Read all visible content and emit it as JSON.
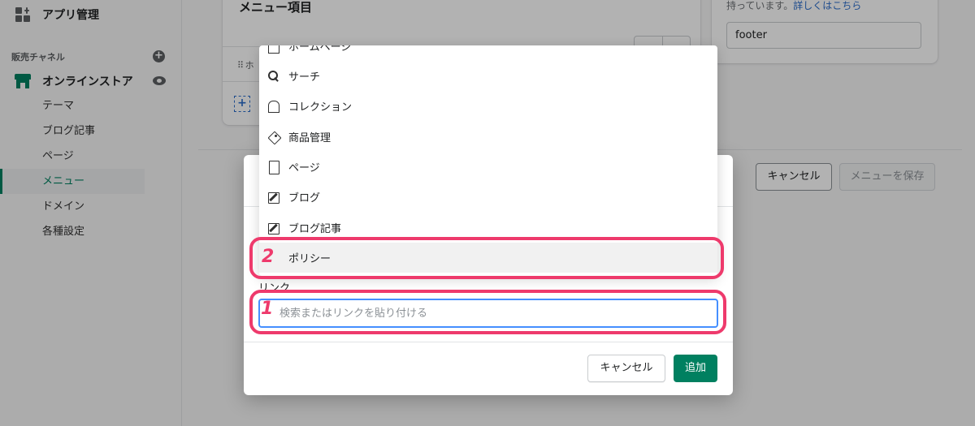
{
  "sidebar": {
    "apps_label": "アプリ管理",
    "channels_label": "販売チャネル",
    "store_label": "オンラインストア",
    "items": [
      {
        "label": "テーマ"
      },
      {
        "label": "ブログ記事"
      },
      {
        "label": "ページ"
      },
      {
        "label": "メニュー"
      },
      {
        "label": "ドメイン"
      },
      {
        "label": "各種設定"
      }
    ]
  },
  "main": {
    "card_title": "メニュー項目",
    "row_label": "ホ",
    "cancel_label": "キャンセル",
    "save_label": "メニューを保存"
  },
  "right": {
    "help_text": "持っています。",
    "help_link": "詳しくはこちら",
    "handle_value": "footer"
  },
  "modal": {
    "link_label": "リンク",
    "link_placeholder": "検索またはリンクを貼り付ける",
    "cancel_label": "キャンセル",
    "add_label": "追加"
  },
  "dropdown": {
    "items": [
      {
        "label": "ホームページ",
        "icon": "home-icon"
      },
      {
        "label": "サーチ",
        "icon": "search-icon"
      },
      {
        "label": "コレクション",
        "icon": "collection-icon"
      },
      {
        "label": "商品管理",
        "icon": "tag-icon"
      },
      {
        "label": "ページ",
        "icon": "page-icon"
      },
      {
        "label": "ブログ",
        "icon": "edit-icon"
      },
      {
        "label": "ブログ記事",
        "icon": "edit-icon"
      },
      {
        "label": "ポリシー",
        "icon": "policy-icon"
      }
    ]
  },
  "annotations": {
    "marker_1": "1",
    "marker_2": "2",
    "color": "#ee3a6c"
  },
  "colors": {
    "accent": "#008060",
    "focus": "#458fff"
  }
}
